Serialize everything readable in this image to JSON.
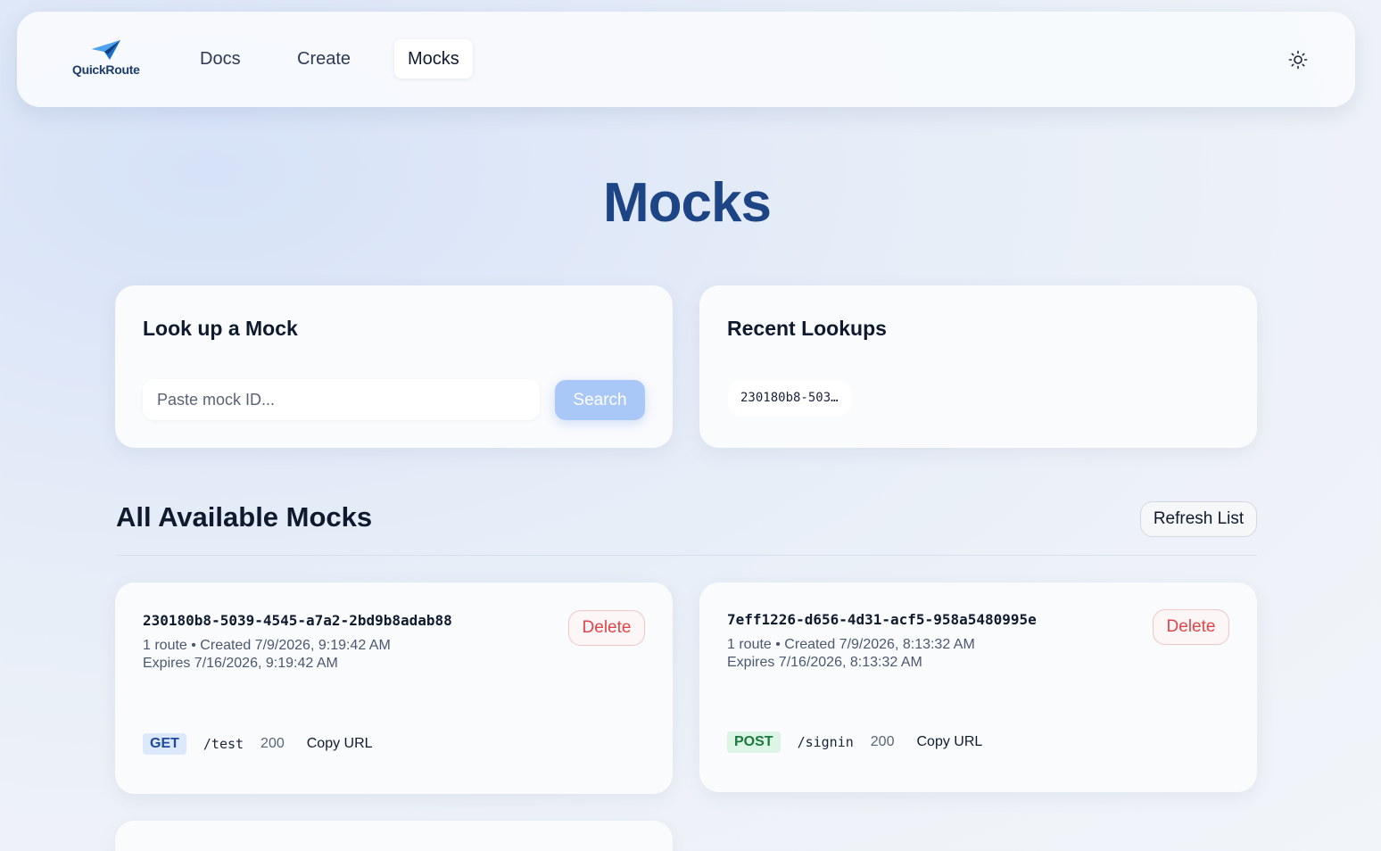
{
  "nav": {
    "logo_text": "QuickRoute",
    "links": [
      {
        "label": "Docs"
      },
      {
        "label": "Create"
      },
      {
        "label": "Mocks"
      }
    ]
  },
  "page": {
    "title": "Mocks"
  },
  "lookup": {
    "heading": "Look up a Mock",
    "placeholder": "Paste mock ID...",
    "search_label": "Search"
  },
  "recent": {
    "heading": "Recent Lookups",
    "items": [
      "230180b8-503…"
    ]
  },
  "all_mocks": {
    "heading": "All Available Mocks",
    "refresh_label": "Refresh List",
    "mocks": [
      {
        "id": "230180b8-5039-4545-a7a2-2bd9b8adab88",
        "summary": "1 route • Created 7/9/2026, 9:19:42 AM",
        "expires": "Expires 7/16/2026, 9:19:42 AM",
        "delete_label": "Delete",
        "route": {
          "method": "GET",
          "path": "/test",
          "status": "200",
          "copy_label": "Copy URL"
        }
      },
      {
        "id": "7eff1226-d656-4d31-acf5-958a5480995e",
        "summary": "1 route • Created 7/9/2026, 8:13:32 AM",
        "expires": "Expires 7/16/2026, 8:13:32 AM",
        "delete_label": "Delete",
        "route": {
          "method": "POST",
          "path": "/signin",
          "status": "200",
          "copy_label": "Copy URL"
        }
      }
    ]
  },
  "colors": {
    "title": "#1d4585",
    "search_button": "#a9c8f7",
    "delete": "#e0454a",
    "get_badge": "#dce8fb",
    "post_badge": "#dcf5e4"
  }
}
